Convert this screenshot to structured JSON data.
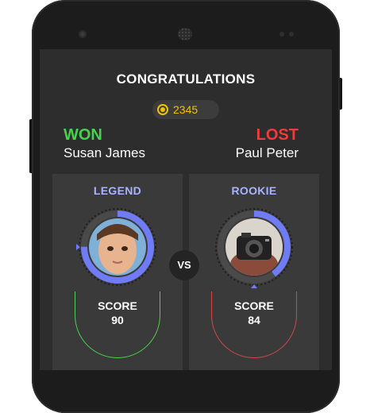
{
  "header": {
    "title": "CONGRATULATIONS"
  },
  "coins": {
    "amount": "2345",
    "icon": "coin-icon",
    "color": "#f2c200"
  },
  "winner": {
    "status": "WON",
    "name": "Susan James",
    "rank": "LEGEND",
    "score_label": "SCORE",
    "score": "90",
    "progress": 0.75,
    "status_color": "#45d34e"
  },
  "loser": {
    "status": "LOST",
    "name": "Paul Peter",
    "rank": "ROOKIE",
    "score_label": "SCORE",
    "score": "84",
    "progress": 0.4,
    "status_color": "#ee3b3b"
  },
  "versus": {
    "label": "VS"
  },
  "colors": {
    "accent": "#6f7cf6",
    "rank_text": "#a9b3ff",
    "card_bg": "#3a3a3a",
    "screen_bg": "#2d2d2d"
  }
}
